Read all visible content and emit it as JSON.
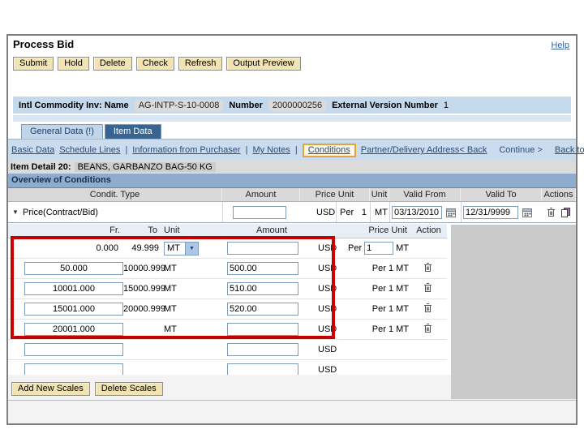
{
  "window": {
    "title": "Process Bid",
    "help_label": "Help"
  },
  "toolbar": {
    "buttons": [
      "Submit",
      "Hold",
      "Delete",
      "Check",
      "Refresh",
      "Output Preview"
    ]
  },
  "info_bar": {
    "name_label": "Intl Commodity Inv: Name",
    "name_value": "AG-INTP-S-10-0008",
    "number_label": "Number",
    "number_value": "2000000256",
    "version_label": "External Version Number",
    "version_value": "1"
  },
  "tabs": [
    {
      "label": "General Data (!)",
      "active": false
    },
    {
      "label": "Item Data",
      "active": true
    }
  ],
  "nav": {
    "left": [
      "Basic Data",
      "Schedule Lines",
      "Information from Purchaser",
      "My Notes",
      "Conditions",
      "Partner/Delivery Address"
    ],
    "highlighted": "Conditions",
    "separators_after": [
      1,
      2,
      3
    ],
    "right": [
      {
        "label": "< Back",
        "underline": true
      },
      {
        "label": "Continue >",
        "underline": false
      },
      {
        "label": "Back to Item Overview",
        "underline": true
      }
    ]
  },
  "item_detail": {
    "label": "Item Detail 20:",
    "value": "BEANS, GARBANZO BAG-50 KG"
  },
  "section_title": "Overview of Conditions",
  "conditions_table": {
    "headers": [
      "Condit. Type",
      "Amount",
      "Price Unit",
      "Unit",
      "Valid From",
      "Valid To",
      "Actions"
    ],
    "row": {
      "type": "Price(Contract/Bid)",
      "amount": "",
      "currency": "USD",
      "per_label": "Per",
      "per_value": "1",
      "unit": "MT",
      "valid_from": "03/13/2010",
      "valid_to": "12/31/9999"
    }
  },
  "scales_table": {
    "headers": [
      "Fr.",
      "To",
      "Unit",
      "Amount",
      "Price Unit",
      "Action"
    ],
    "rows": [
      {
        "fr": "0.000",
        "fr_type": "text",
        "to": "49.999",
        "unit": "MT",
        "unit_type": "select",
        "amount": "",
        "currency": "USD",
        "price_unit_type": "editable",
        "per_label": "Per",
        "per_value": "1",
        "per_unit": "MT",
        "trash": false
      },
      {
        "fr": "50.000",
        "fr_type": "input",
        "to": "10000.999",
        "unit": "MT",
        "unit_type": "text",
        "amount": "500.00",
        "currency": "USD",
        "price_unit_type": "text",
        "price_unit": "Per 1 MT",
        "trash": true
      },
      {
        "fr": "10001.000",
        "fr_type": "input",
        "to": "15000.999",
        "unit": "MT",
        "unit_type": "text",
        "amount": "510.00",
        "currency": "USD",
        "price_unit_type": "text",
        "price_unit": "Per 1 MT",
        "trash": true
      },
      {
        "fr": "15001.000",
        "fr_type": "input",
        "to": "20000.999",
        "unit": "MT",
        "unit_type": "text",
        "amount": "520.00",
        "currency": "USD",
        "price_unit_type": "text",
        "price_unit": "Per 1 MT",
        "trash": true
      },
      {
        "fr": "20001.000",
        "fr_type": "input",
        "to": "",
        "unit": "MT",
        "unit_type": "text",
        "amount": "",
        "currency": "USD",
        "price_unit_type": "text",
        "price_unit": "Per 1 MT",
        "trash": true
      },
      {
        "fr": "",
        "fr_type": "input",
        "to": "",
        "unit": "",
        "unit_type": "none",
        "amount": "",
        "currency": "USD",
        "price_unit_type": "none",
        "trash": false
      },
      {
        "fr": "",
        "fr_type": "input",
        "to": "",
        "unit": "",
        "unit_type": "none",
        "amount": "",
        "currency": "USD",
        "price_unit_type": "none",
        "trash": false
      }
    ]
  },
  "footer": {
    "buttons": [
      "Add New Scales",
      "Delete Scales"
    ]
  },
  "colors": {
    "highlight_red": "#C80000",
    "tab_active_blue": "#39648F",
    "button_tan": "#F2E3B3",
    "bar_blue": "#CBDCEE",
    "section_blue": "#8FACCE",
    "panel_gray": "#C9C9C9"
  }
}
